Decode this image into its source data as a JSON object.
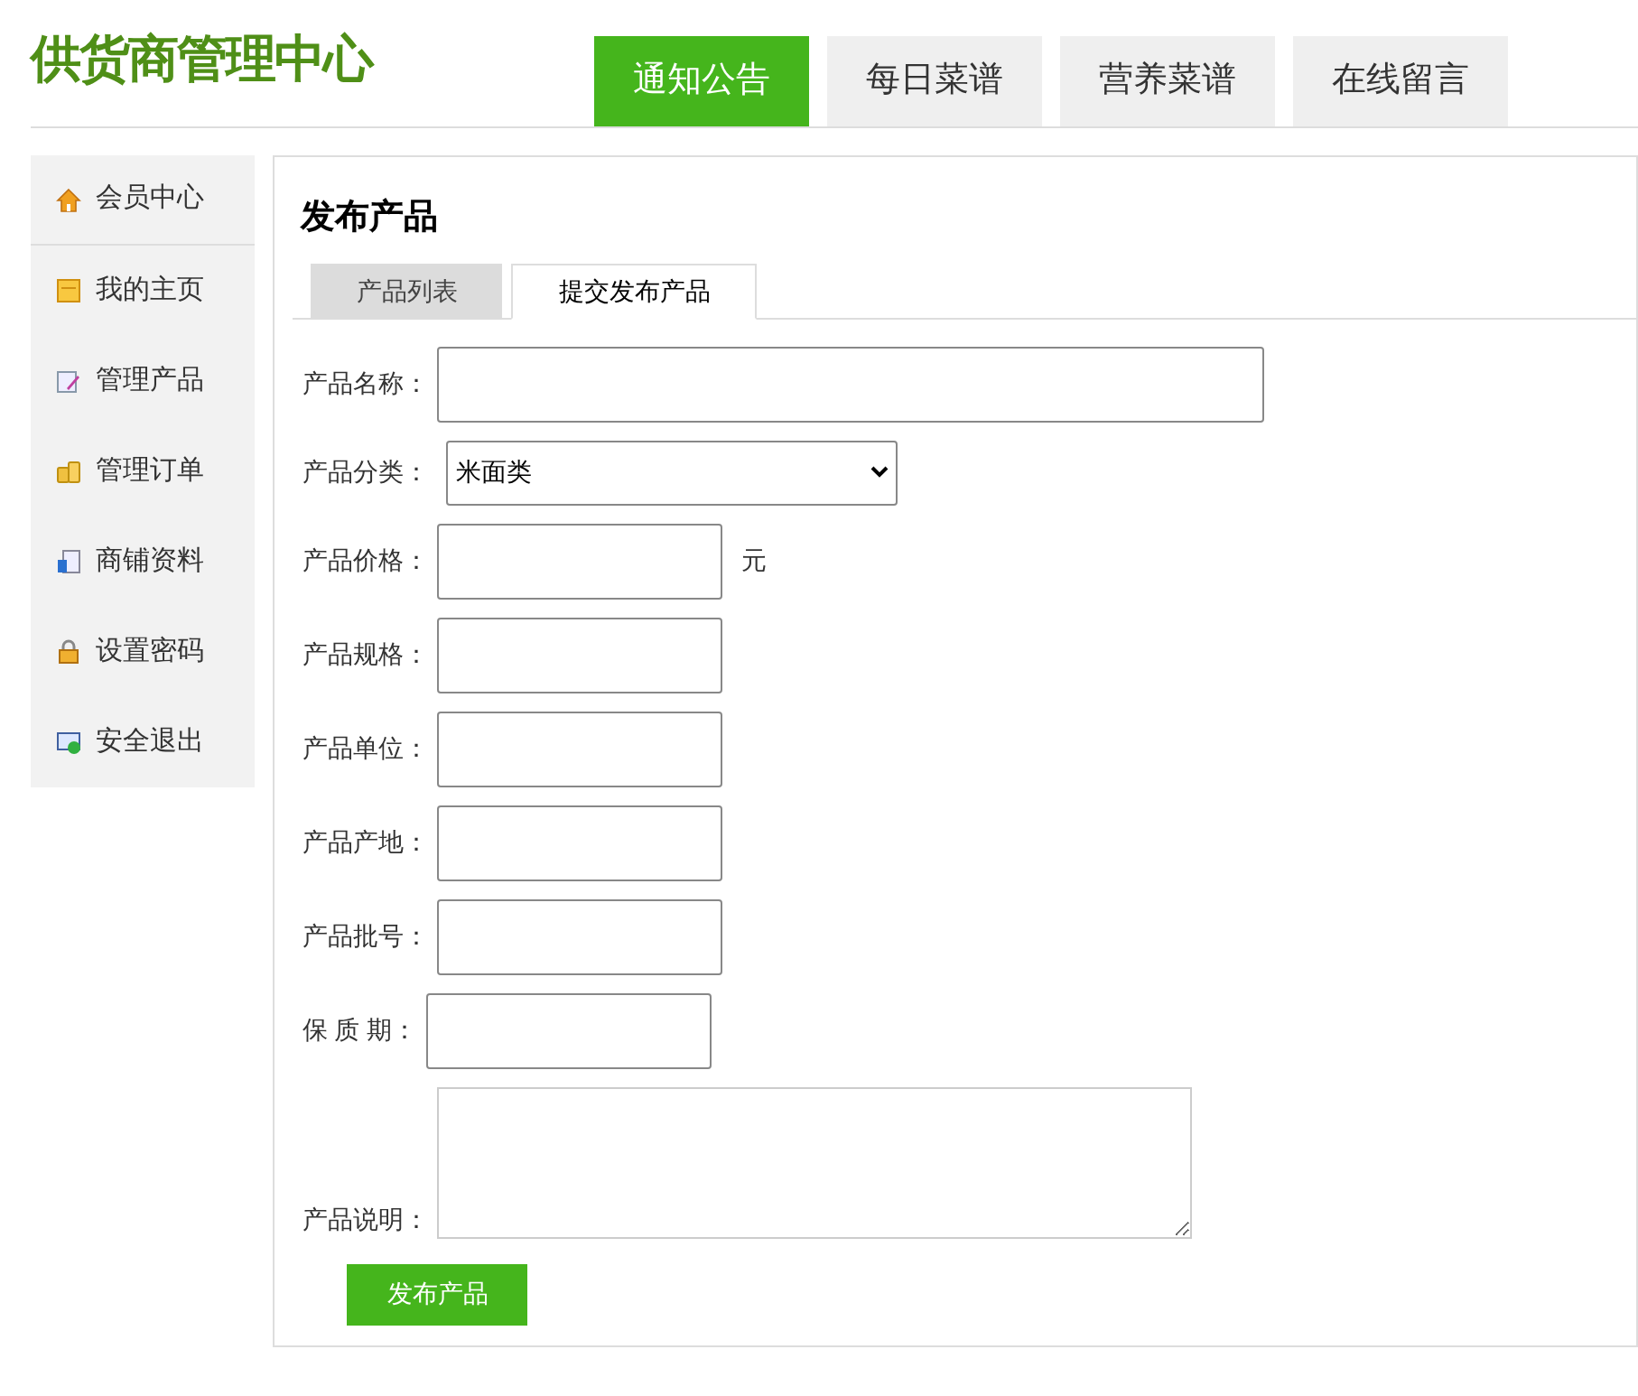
{
  "logo": "供货商管理中心",
  "nav": [
    {
      "label": "通知公告",
      "selected": true
    },
    {
      "label": "每日菜谱",
      "selected": false
    },
    {
      "label": "营养菜谱",
      "selected": false
    },
    {
      "label": "在线留言",
      "selected": false
    }
  ],
  "sidebar": {
    "items": [
      {
        "label": "会员中心",
        "selected": true
      },
      {
        "label": "我的主页",
        "selected": false
      },
      {
        "label": "管理产品",
        "selected": false
      },
      {
        "label": "管理订单",
        "selected": false
      },
      {
        "label": "商铺资料",
        "selected": false
      },
      {
        "label": "设置密码",
        "selected": false
      },
      {
        "label": "安全退出",
        "selected": false
      }
    ]
  },
  "panel": {
    "title": "发布产品",
    "tabs": [
      {
        "label": "产品列表",
        "selected": false
      },
      {
        "label": "提交发布产品",
        "selected": true
      }
    ],
    "form": [
      {
        "kind": "wide_text",
        "label": "产品名称："
      },
      {
        "kind": "select",
        "label": "产品分类：",
        "value": "米面类"
      },
      {
        "kind": "text",
        "label": "产品价格：",
        "unit": "元"
      },
      {
        "kind": "text",
        "label": "产品规格："
      },
      {
        "kind": "text",
        "label": "产品单位："
      },
      {
        "kind": "text",
        "label": "产品产地："
      },
      {
        "kind": "text",
        "label": "产品批号："
      },
      {
        "kind": "text",
        "label": "保 质 期："
      },
      {
        "kind": "textarea",
        "label": "产品说明："
      }
    ],
    "submit": "发布产品"
  }
}
